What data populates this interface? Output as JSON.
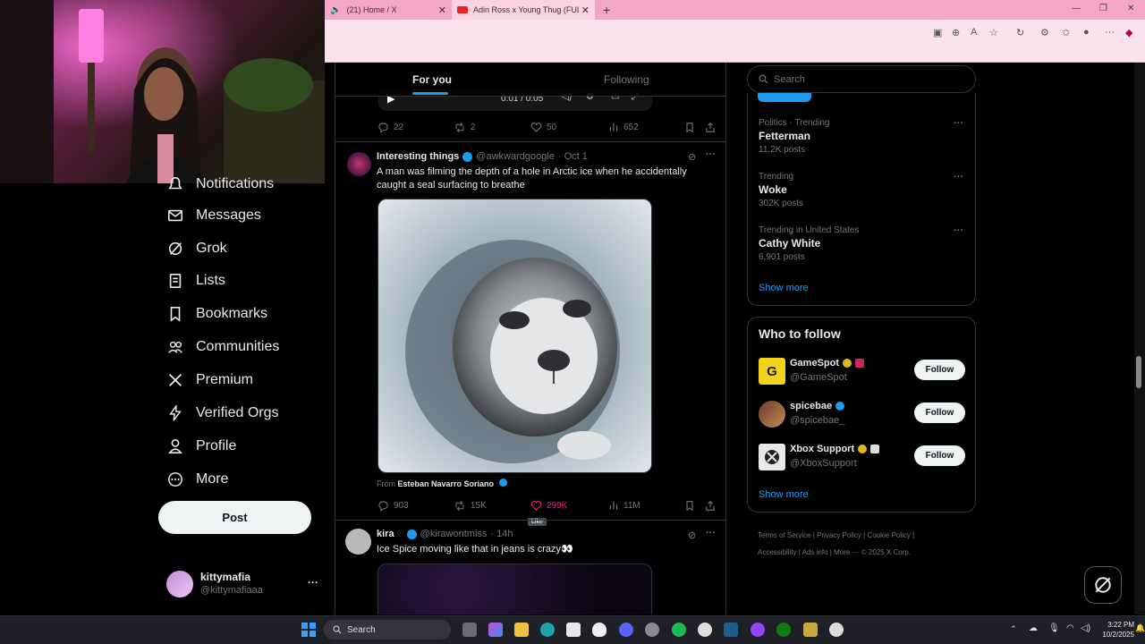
{
  "browser": {
    "tabs": [
      {
        "title": "(21) Home / X"
      },
      {
        "title": "Adin Ross x Young Thug (FULL ST"
      }
    ],
    "new_tab": "+"
  },
  "nav": {
    "items": [
      {
        "label": "Notifications",
        "icon": "bell-icon"
      },
      {
        "label": "Messages",
        "icon": "envelope-icon"
      },
      {
        "label": "Grok",
        "icon": "grok-icon"
      },
      {
        "label": "Lists",
        "icon": "list-icon"
      },
      {
        "label": "Bookmarks",
        "icon": "bookmark-icon"
      },
      {
        "label": "Communities",
        "icon": "people-icon"
      },
      {
        "label": "Premium",
        "icon": "x-logo-icon"
      },
      {
        "label": "Verified Orgs",
        "icon": "lightning-icon"
      },
      {
        "label": "Profile",
        "icon": "person-icon"
      },
      {
        "label": "More",
        "icon": "more-circle-icon"
      }
    ],
    "post_button": "Post",
    "account": {
      "name": "kittymafia",
      "handle": "@kittymafiaaa",
      "menu": "···"
    }
  },
  "timeline": {
    "tabs": {
      "for_you": "For you",
      "following": "Following"
    },
    "video_time": "0:01 / 0:05",
    "post0_metrics": {
      "replies": "22",
      "reposts": "2",
      "likes": "50",
      "views": "652"
    },
    "post1": {
      "author": "Interesting things",
      "handle": "@awkwardgoogle",
      "date": "· Oct 1",
      "text": "A man was filming the depth of a hole in Arctic ice when he accidentally caught a seal surfacing to breathe",
      "from_prefix": "From",
      "from_name": "Esteban Navarro Soriano",
      "metrics": {
        "replies": "903",
        "reposts": "15K",
        "likes": "299K",
        "views": "11M"
      },
      "tooltip": "Like"
    },
    "post2": {
      "author": "kira",
      "handle": "@kirawontmiss",
      "date": "· 14h",
      "text": "Ice Spice moving like that in jeans is crazy👀"
    }
  },
  "sidebar": {
    "search_placeholder": "Search",
    "trends": [
      {
        "context": "Politics · Trending",
        "name": "Fetterman",
        "count": "11.2K posts"
      },
      {
        "context": "Trending",
        "name": "Woke",
        "count": "302K posts"
      },
      {
        "context": "Trending in United States",
        "name": "Cathy White",
        "count": "6,901 posts"
      }
    ],
    "show_more": "Show more",
    "who_to_follow": {
      "title": "Who to follow",
      "accounts": [
        {
          "name": "GameSpot",
          "handle": "@GameSpot"
        },
        {
          "name": "spicebae",
          "handle": "@spicebae_"
        },
        {
          "name": "Xbox Support",
          "handle": "@XboxSupport"
        }
      ],
      "follow_label": "Follow",
      "show_more": "Show more"
    },
    "footer": [
      "Terms of Service",
      "Privacy Policy",
      "Cookie Policy",
      "Accessibility",
      "Ads info",
      "More ···",
      "© 2025 X Corp."
    ]
  },
  "taskbar": {
    "search": "Search",
    "time": "3:22 PM",
    "date": "10/2/2025"
  },
  "colors": {
    "accent": "#1d9bf0",
    "like": "#f91880",
    "tab_pink": "#f4a6c6"
  }
}
